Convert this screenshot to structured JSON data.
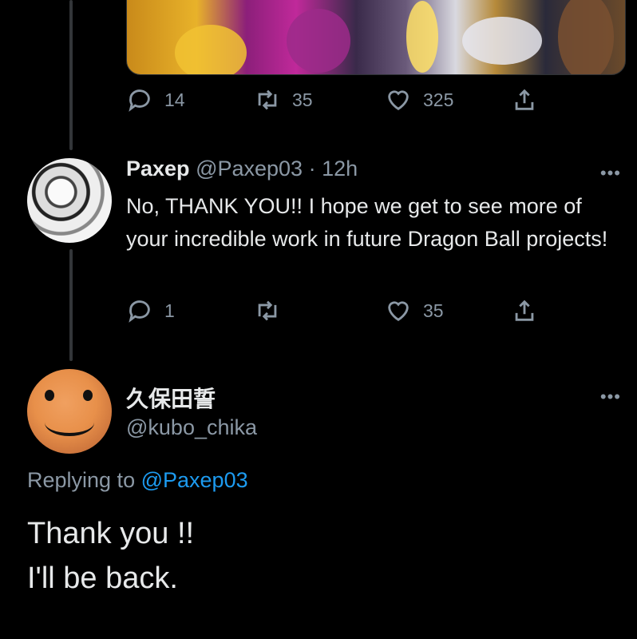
{
  "colors": {
    "background": "#000000",
    "text": "#e7e9ea",
    "muted": "#8b98a5",
    "accent": "#1d9bf0"
  },
  "top_tweet": {
    "media_alt": "",
    "actions": {
      "replies": "14",
      "retweets": "35",
      "likes": "325"
    }
  },
  "reply_tweet": {
    "display_name": "Paxep",
    "handle": "@Paxep03",
    "separator": "·",
    "time": "12h",
    "more": "•••",
    "text": "No, THANK YOU!! I hope we get to see more of your incredible work in future Dragon Ball projects!",
    "actions": {
      "replies": "1",
      "retweets": "",
      "likes": "35"
    }
  },
  "main_tweet": {
    "display_name": "久保田誓",
    "handle": "@kubo_chika",
    "more": "•••",
    "replying_prefix": "Replying to",
    "replying_mention": "@Paxep03",
    "line1": "Thank you !!",
    "line2": "I'll be back."
  },
  "icons": [
    "reply-icon",
    "retweet-icon",
    "like-icon",
    "share-icon",
    "more-icon"
  ]
}
